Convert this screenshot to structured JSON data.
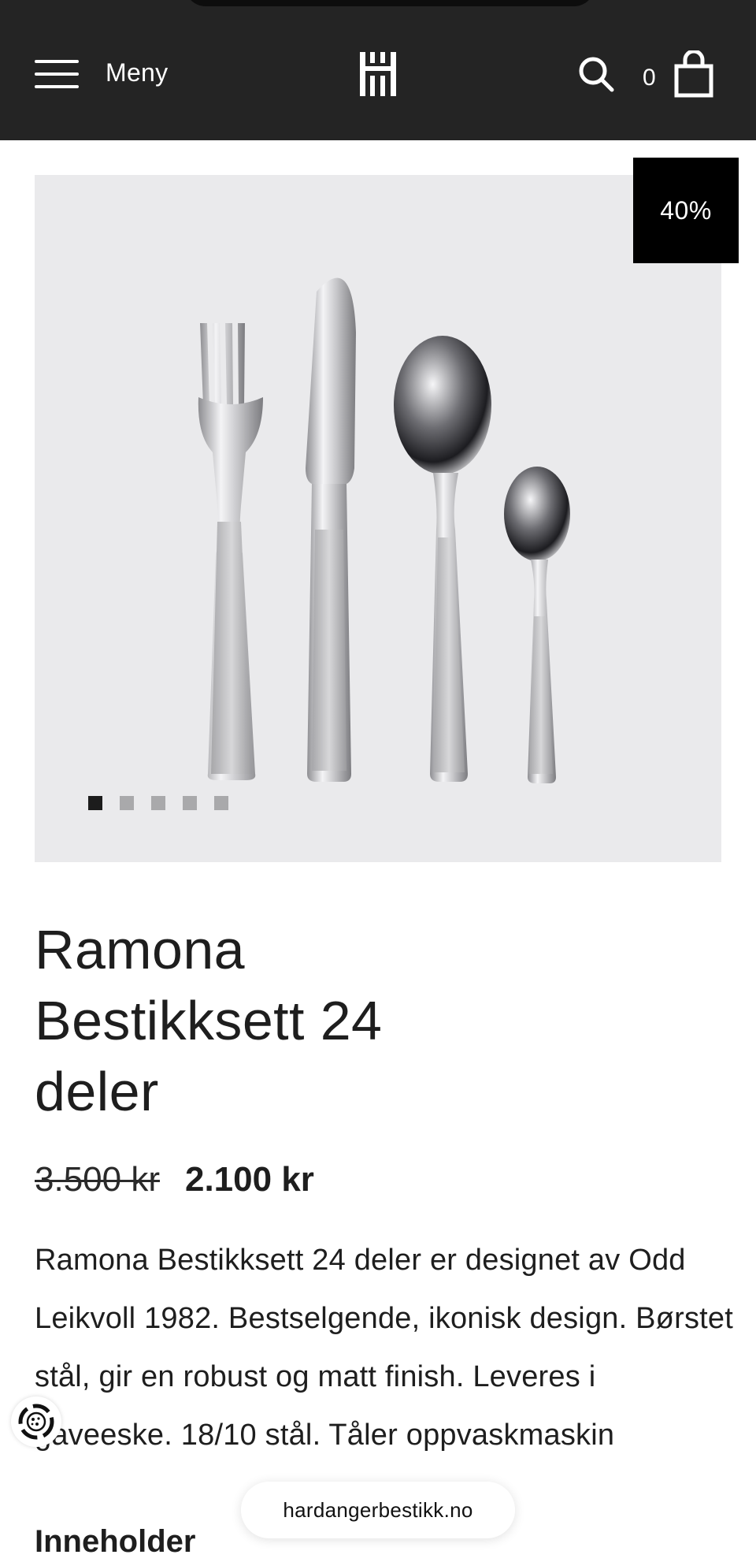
{
  "header": {
    "menu_label": "Meny",
    "menu_icon": "hamburger-icon",
    "logo_icon": "hardanger-logo-icon",
    "search_icon": "search-icon",
    "cart_count": "0",
    "cart_icon": "shopping-bag-icon"
  },
  "gallery": {
    "discount_badge": "40%",
    "image_count": 5,
    "active_index": 1,
    "image_description_icon": "cutlery-set-image"
  },
  "product": {
    "title_lines": [
      "Ramona",
      "Bestikksett 24",
      "deler"
    ],
    "old_price": "3.500 kr",
    "new_price": "2.100 kr",
    "description": "Ramona Bestikksett 24 deler er designet av Odd Leikvoll 1982. Bestselgende, ikonisk design. Børstet stål, gir en robust og matt finish. Leveres i gaveeske. 18/10 stål. Tåler oppvaskmaskin",
    "contents_heading": "Inneholder"
  },
  "browser": {
    "url": "hardangerbestikk.no"
  },
  "colors": {
    "header_bg": "#242424",
    "gallery_bg": "#eaeaec",
    "badge_bg": "#000000",
    "text": "#1e1e1e"
  }
}
